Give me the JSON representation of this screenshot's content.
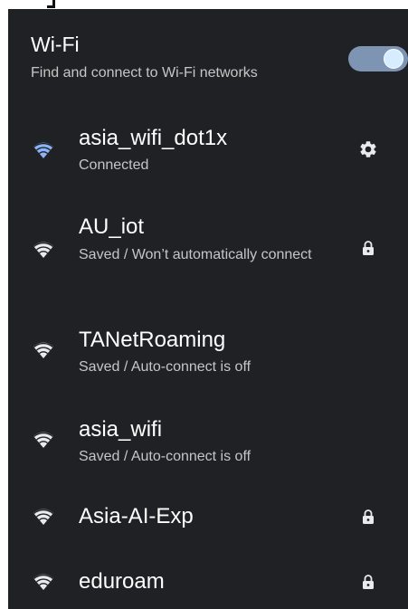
{
  "wifi": {
    "title": "Wi-Fi",
    "subtitle": "Find and connect to Wi-Fi networks",
    "enabled": true
  },
  "networks": [
    {
      "name": "asia_wifi_dot1x",
      "status": "Connected",
      "icon": "wifi-signal-icon",
      "trailing": "gear-icon",
      "color": "#8ab4f8"
    },
    {
      "name": "AU_iot",
      "status": "Saved / Won’t automatically connect",
      "icon": "wifi-signal-icon",
      "trailing": "lock-icon",
      "color": "#e8eaed"
    },
    {
      "name": "TANetRoaming",
      "status": "Saved / Auto-connect is off",
      "icon": "wifi-signal-icon",
      "trailing": "",
      "color": "#e8eaed"
    },
    {
      "name": "asia_wifi",
      "status": "Saved / Auto-connect is off",
      "icon": "wifi-signal-icon",
      "trailing": "",
      "color": "#e8eaed"
    },
    {
      "name": "Asia-AI-Exp",
      "status": "",
      "icon": "wifi-signal-icon",
      "trailing": "lock-icon",
      "color": "#e8eaed"
    },
    {
      "name": "eduroam",
      "status": "",
      "icon": "wifi-signal-icon",
      "trailing": "lock-icon",
      "color": "#e8eaed"
    }
  ]
}
